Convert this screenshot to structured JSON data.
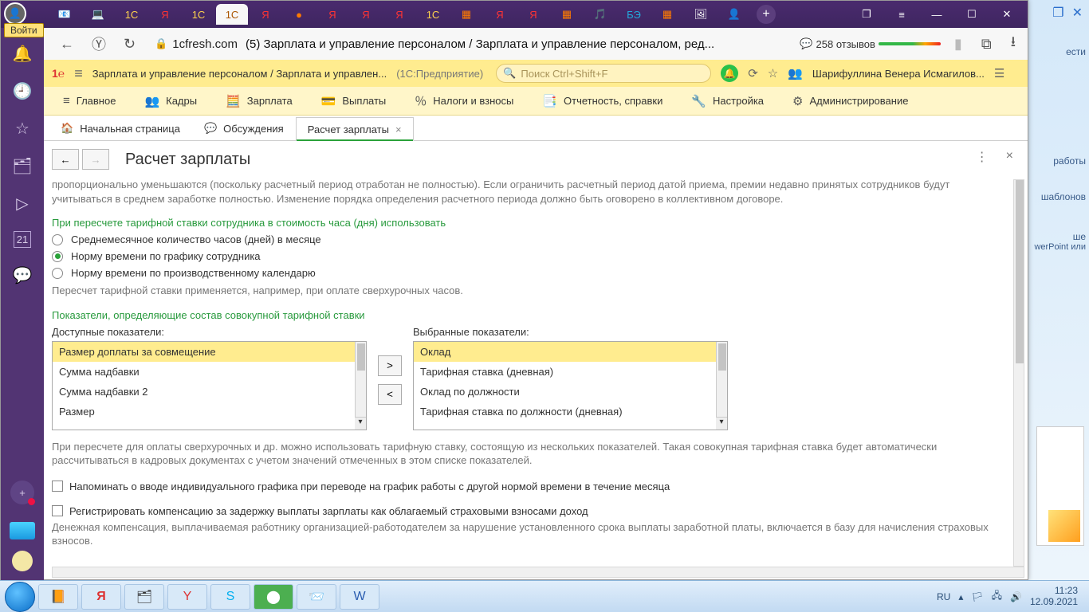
{
  "login_label": "Войти",
  "browser": {
    "url_host": "1cfresh.com",
    "tab_title": "(5) Зарплата и управление персоналом / Зарплата и управление персоналом, ред...",
    "reviews": "258 отзывов"
  },
  "app_header": {
    "path": "Зарплата и управление персоналом / Зарплата и управлен...",
    "mode": "(1С:Предприятие)",
    "search_placeholder": "Поиск Ctrl+Shift+F",
    "user": "Шарифуллина Венера Исмагилов..."
  },
  "sections": [
    "Главное",
    "Кадры",
    "Зарплата",
    "Выплаты",
    "Налоги и взносы",
    "Отчетность, справки",
    "Настройка",
    "Администрирование"
  ],
  "navtabs": {
    "home": "Начальная страница",
    "disc": "Обсуждения",
    "active": "Расчет зарплаты"
  },
  "page": {
    "title": "Расчет зарплаты",
    "para1": "пропорционально уменьшаются (поскольку расчетный период отработан не полностью). Если ограничить расчетный период датой приема, премии недавно принятых сотрудников будут учитываться в среднем заработке полностью. Изменение порядка определения расчетного периода должно быть оговорено в коллективном договоре.",
    "green1": "При пересчете тарифной ставки сотрудника в стоимость часа (дня) использовать",
    "radios": {
      "r1": "Среднемесячное количество часов (дней) в месяце",
      "r2": "Норму времени по графику сотрудника",
      "r3": "Норму времени по производственному календарю"
    },
    "note": "Пересчет тарифной ставки применяется, например, при оплате сверхурочных часов.",
    "green2": "Показатели, определяющие состав совокупной тарифной ставки",
    "avail_label": "Доступные показатели:",
    "sel_label": "Выбранные показатели:",
    "avail": [
      "Размер доплаты за совмещение",
      "Сумма надбавки",
      "Сумма надбавки 2",
      "Размер"
    ],
    "selected": [
      "Оклад",
      "Тарифная ставка (дневная)",
      "Оклад по должности",
      "Тарифная ставка по должности (дневная)"
    ],
    "para2": "При пересчете для оплаты сверхурочных и др. можно использовать тарифную ставку, состоящую из нескольких показателей. Такая совокупная тарифная ставка будет автоматически рассчитываться в кадровых документах с учетом значений отмеченных в этом списке показателей.",
    "chk1": "Напоминать о вводе индивидуального графика при переводе на график работы с другой нормой времени в течение месяца",
    "chk2": "Регистрировать компенсацию за задержку выплаты зарплаты как облагаемый страховыми взносами доход",
    "para3": "Денежная компенсация, выплачиваемая работнику организацией-работодателем за нарушение установленного срока выплаты заработной платы, включается в базу для начисления страховых взносов."
  },
  "desktop_hints": {
    "d2": "работы",
    "d3": "шаблонов",
    "d4": "ше",
    "d5": "werPoint или"
  },
  "tray": {
    "lang": "RU",
    "time": "11:23",
    "date": "12.09.2021"
  }
}
